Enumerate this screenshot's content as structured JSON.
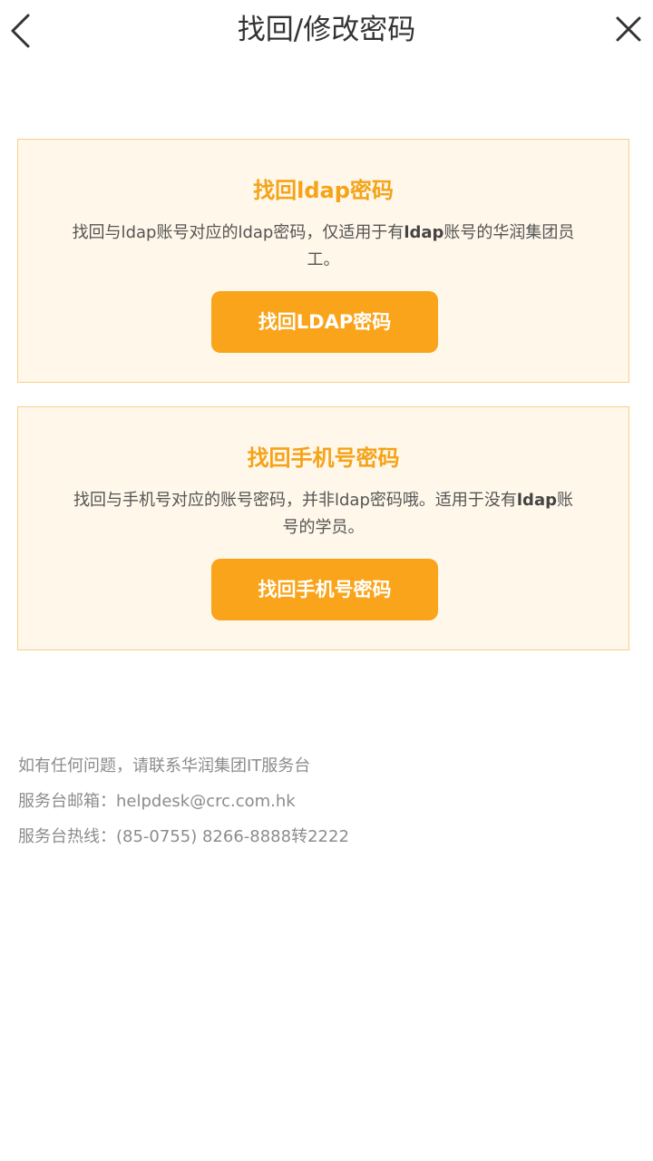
{
  "header": {
    "title": "找回/修改密码",
    "back_icon": "chevron-left-icon",
    "close_icon": "close-icon"
  },
  "cards": [
    {
      "title": "找回ldap密码",
      "desc_part1": "找回与ldap账号对应的ldap密码，仅适用于有",
      "desc_bold": "ldap",
      "desc_part2": "账号的华润集团员工。",
      "button_label": "找回LDAP密码"
    },
    {
      "title": "找回手机号密码",
      "desc_part1": "找回与手机号对应的账号密码，并非ldap密码哦。适用于没有",
      "desc_bold": "ldap",
      "desc_part2": "账号的学员。",
      "button_label": "找回手机号密码"
    }
  ],
  "info": {
    "line1": "如有任何问题，请联系华润集团IT服务台",
    "line2": "服务台邮箱：helpdesk@crc.com.hk",
    "line3": "服务台热线：(85-0755) 8266-8888转2222"
  },
  "colors": {
    "accent": "#f9a41a",
    "title_accent": "#f5a318",
    "card_bg": "#fff7ea",
    "card_border": "#f7cf8a"
  }
}
